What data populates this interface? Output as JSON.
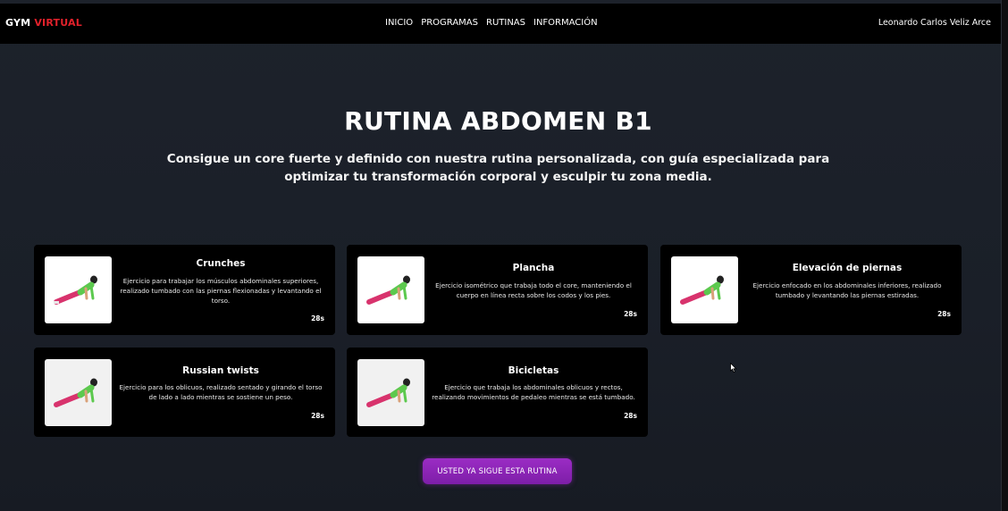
{
  "brand": {
    "part1": "GYM",
    "part2": "VIRTUAL",
    "accent_color": "#e1212b"
  },
  "nav": {
    "items": [
      "INICIO",
      "PROGRAMAS",
      "RUTINAS",
      "INFORMACIÓN"
    ]
  },
  "user": {
    "name": "Leonardo Carlos Veliz Arce"
  },
  "routine": {
    "title": "RUTINA ABDOMEN B1",
    "subtitle": "Consigue un core fuerte y definido con nuestra rutina personalizada, con guía especializada para optimizar tu transformación corporal y esculpir tu zona media."
  },
  "exercises": [
    {
      "name": "Crunches",
      "description": "Ejercicio para trabajar los músculos abdominales superiores, realizado tumbado con las piernas flexionadas y levantando el torso.",
      "duration": "28s",
      "image_icon": "plank-figure-icon"
    },
    {
      "name": "Plancha",
      "description": "Ejercicio isométrico que trabaja todo el core, manteniendo el cuerpo en línea recta sobre los codos y los pies.",
      "duration": "28s",
      "image_icon": "plank-figure-icon"
    },
    {
      "name": "Elevación de piernas",
      "description": "Ejercicio enfocado en los abdominales inferiores, realizado tumbado y levantando las piernas estiradas.",
      "duration": "28s",
      "image_icon": "plank-figure-icon"
    },
    {
      "name": "Russian twists",
      "description": "Ejercicio para los oblicuos, realizado sentado y girando el torso de lado a lado mientras se sostiene un peso.",
      "duration": "28s",
      "image_icon": "plank-figure-icon"
    },
    {
      "name": "Bicicletas",
      "description": "Ejercicio que trabaja los abdominales oblicuos y rectos, realizando movimientos de pedaleo mientras se está tumbado.",
      "duration": "28s",
      "image_icon": "plank-figure-icon"
    }
  ],
  "cta": {
    "label": "USTED YA SIGUE ESTA RUTINA",
    "color": "#8e27ba"
  }
}
